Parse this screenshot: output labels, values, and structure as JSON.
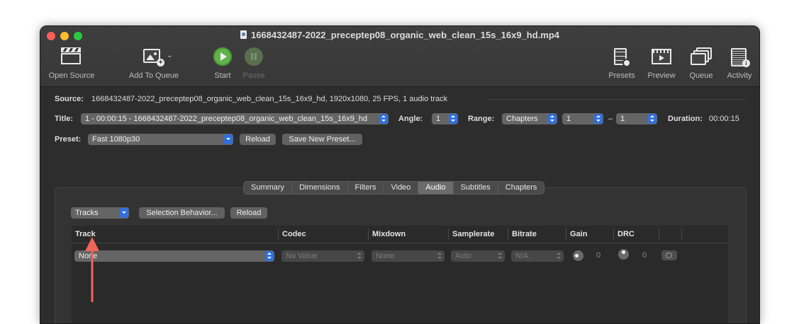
{
  "window": {
    "title": "1668432487-2022_preceptep08_organic_web_clean_15s_16x9_hd.mp4"
  },
  "toolbar": {
    "open_source": "Open Source",
    "add_to_queue": "Add To Queue",
    "start": "Start",
    "pause": "Pause",
    "presets": "Presets",
    "preview": "Preview",
    "queue": "Queue",
    "activity": "Activity"
  },
  "source": {
    "label": "Source:",
    "value": "1668432487-2022_preceptep08_organic_web_clean_15s_16x9_hd, 1920x1080, 25 FPS, 1 audio track"
  },
  "title_row": {
    "label": "Title:",
    "value": "1 - 00:00:15 - 1668432487-2022_preceptep08_organic_web_clean_15s_16x9_hd",
    "angle_label": "Angle:",
    "angle_value": "1",
    "range_label": "Range:",
    "range_mode": "Chapters",
    "range_start": "1",
    "range_dash": "–",
    "range_end": "1",
    "duration_label": "Duration:",
    "duration_value": "00:00:15"
  },
  "preset_row": {
    "label": "Preset:",
    "value": "Fast 1080p30",
    "reload": "Reload",
    "save_new": "Save New Preset..."
  },
  "tabs": [
    "Summary",
    "Dimensions",
    "Filters",
    "Video",
    "Audio",
    "Subtitles",
    "Chapters"
  ],
  "active_tab": "Audio",
  "audio": {
    "tracks_popup": "Tracks",
    "selection_behavior": "Selection Behavior...",
    "reload": "Reload",
    "columns": [
      "Track",
      "Codec",
      "Mixdown",
      "Samplerate",
      "Bitrate",
      "Gain",
      "DRC"
    ],
    "row": {
      "track": "None",
      "codec": "No Value",
      "mixdown": "None",
      "samplerate": "Auto",
      "bitrate": "N/A",
      "gain": "0",
      "drc": "0"
    }
  },
  "colors": {
    "annotation_arrow": "#f0645a",
    "accent": "#2f6fdf"
  }
}
